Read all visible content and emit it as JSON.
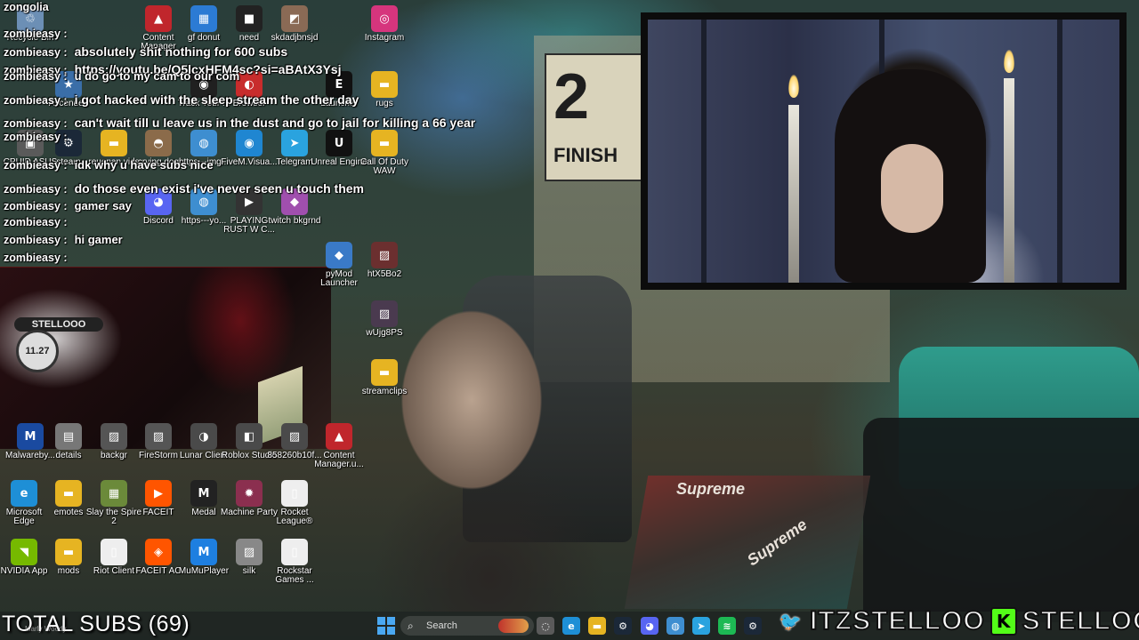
{
  "chat": {
    "lines": [
      {
        "user": "zongolia",
        "msg": ""
      },
      {
        "user": "zombieasy :",
        "msg": ""
      },
      {
        "user": "zombieasy :",
        "msg": "absolutely shit nothing for 600 subs"
      },
      {
        "user": "zombieasy :",
        "msg": "https://youtu.be/Q5lcxHFM4sc?si=aBAtX3Ysj"
      },
      {
        "user": "zombieasy :",
        "msg": "u do go to my cam to our com"
      },
      {
        "user": "zombieasy :",
        "msg": "i got hacked with the sleep stream the other day"
      },
      {
        "user": "zombieasy :",
        "msg": "can't wait till u leave us in the dust and go to jail for killing a 66 year"
      },
      {
        "user": "zombieasy :",
        "msg": ""
      },
      {
        "user": "zombieasy :",
        "msg": "idk why u have subs nice"
      },
      {
        "user": "zombieasy :",
        "msg": "do those even exist i've never seen u touch them"
      },
      {
        "user": "zombieasy :",
        "msg": "gamer say"
      },
      {
        "user": "zombieasy :",
        "msg": ""
      },
      {
        "user": "zombieasy :",
        "msg": "hi gamer"
      },
      {
        "user": "zombieasy :",
        "msg": ""
      }
    ]
  },
  "desktop_icons": [
    {
      "label": "Recycle Bin",
      "glyph": "♲",
      "color": "#6c8fb5"
    },
    {
      "label": "Content Manager",
      "glyph": "▲",
      "color": "#c0262c"
    },
    {
      "label": "gf donut",
      "glyph": "▦",
      "color": "#2c7bd4"
    },
    {
      "label": "need",
      "glyph": "■",
      "color": "#222222"
    },
    {
      "label": "skdadjbnsjd",
      "glyph": "◩",
      "color": "#8a6a55"
    },
    {
      "label": "Instagram",
      "glyph": "◎",
      "color": "#d6357d"
    },
    {
      "label": "Ascended",
      "glyph": "★",
      "color": "#3a6ea8"
    },
    {
      "label": "Track Your ...",
      "glyph": "◉",
      "color": "#202020"
    },
    {
      "label": "Browser",
      "glyph": "◐",
      "color": "#c82c2c"
    },
    {
      "label": "Launcher",
      "glyph": "E",
      "color": "#111111"
    },
    {
      "label": "rugs",
      "glyph": "▬",
      "color": "#e6b422"
    },
    {
      "label": "CPUID ASUS",
      "glyph": "▣",
      "color": "#5a5a5a"
    },
    {
      "label": "steam",
      "glyph": "⚙",
      "color": "#1b2838"
    },
    {
      "label": "reuenan vids",
      "glyph": "▬",
      "color": "#e6b422"
    },
    {
      "label": "crying dog",
      "glyph": "◓",
      "color": "#8b6b4a"
    },
    {
      "label": "https---img...",
      "glyph": "◍",
      "color": "#3e8ed0"
    },
    {
      "label": "FiveM.Visua...",
      "glyph": "◉",
      "color": "#1f86d1"
    },
    {
      "label": "Telegram",
      "glyph": "➤",
      "color": "#2aa3df"
    },
    {
      "label": "Unreal Engine",
      "glyph": "U",
      "color": "#111111"
    },
    {
      "label": "Call Of Duty WAW",
      "glyph": "▬",
      "color": "#e6b422"
    },
    {
      "label": "Discord",
      "glyph": "◕",
      "color": "#5865f2"
    },
    {
      "label": "https---yo...",
      "glyph": "◍",
      "color": "#3e8ed0"
    },
    {
      "label": "PLAYING RUST W C...",
      "glyph": "▶",
      "color": "#333333"
    },
    {
      "label": "twitch bkgrnd",
      "glyph": "◆",
      "color": "#a04fae"
    },
    {
      "label": "pyMod Launcher",
      "glyph": "◆",
      "color": "#3a7ac7"
    },
    {
      "label": "htX5Bo2",
      "glyph": "▨",
      "color": "#6b2f2f"
    },
    {
      "label": "wUjg8PS",
      "glyph": "▨",
      "color": "#4a3a4f"
    },
    {
      "label": "streamclips",
      "glyph": "▬",
      "color": "#e6b422"
    },
    {
      "label": "Malwareby...",
      "glyph": "M",
      "color": "#1a4aa0"
    },
    {
      "label": "details",
      "glyph": "▤",
      "color": "#777777"
    },
    {
      "label": "backgr",
      "glyph": "▨",
      "color": "#555555"
    },
    {
      "label": "FireStorm",
      "glyph": "▨",
      "color": "#555555"
    },
    {
      "label": "Lunar Client",
      "glyph": "◑",
      "color": "#4a4a4a"
    },
    {
      "label": "Roblox Studio",
      "glyph": "◧",
      "color": "#4a4a4a"
    },
    {
      "label": "858260b10f...",
      "glyph": "▨",
      "color": "#4a4a4a"
    },
    {
      "label": "Content Manager.u...",
      "glyph": "▲",
      "color": "#c0262c"
    },
    {
      "label": "Microsoft Edge",
      "glyph": "e",
      "color": "#1e8fd6"
    },
    {
      "label": "emotes",
      "glyph": "▬",
      "color": "#e6b422"
    },
    {
      "label": "Slay the Spire 2",
      "glyph": "▦",
      "color": "#6b8a3a"
    },
    {
      "label": "FACEIT",
      "glyph": "▶",
      "color": "#ff5500"
    },
    {
      "label": "Medal",
      "glyph": "M",
      "color": "#222222"
    },
    {
      "label": "Machine Party",
      "glyph": "✹",
      "color": "#8b2f4f"
    },
    {
      "label": "Rocket League®",
      "glyph": "▯",
      "color": "#eeeeee"
    },
    {
      "label": "NVIDIA App",
      "glyph": "◥",
      "color": "#76b900"
    },
    {
      "label": "mods",
      "glyph": "▬",
      "color": "#e6b422"
    },
    {
      "label": "Riot Client",
      "glyph": "▯",
      "color": "#eeeeee"
    },
    {
      "label": "FACEIT AC",
      "glyph": "◈",
      "color": "#ff5500"
    },
    {
      "label": "MuMuPlayer",
      "glyph": "M",
      "color": "#1e7fe0"
    },
    {
      "label": "silk",
      "glyph": "▨",
      "color": "#888888"
    },
    {
      "label": "Rockstar Games ...",
      "glyph": "▯",
      "color": "#eeeeee"
    }
  ],
  "webcam_inset": {
    "banner": "STELLOOO",
    "disc": "11.27"
  },
  "background_scene": {
    "sign_number": "2",
    "sign_word": "FINISH",
    "rug_text": "Supreme",
    "rug_text_2": "Supreme"
  },
  "taskbar": {
    "search_placeholder": "Search",
    "search_icon": "search-icon",
    "start_icon": "windows-start-icon",
    "apps": [
      {
        "name": "copilot-icon",
        "glyph": "◌",
        "color": "#5a5a5a"
      },
      {
        "name": "edge-icon",
        "glyph": "e",
        "color": "#1e8fd6"
      },
      {
        "name": "file-explorer-icon",
        "glyph": "▬",
        "color": "#e6b422"
      },
      {
        "name": "steam-icon",
        "glyph": "⚙",
        "color": "#1b2838"
      },
      {
        "name": "discord-icon",
        "glyph": "◕",
        "color": "#5865f2"
      },
      {
        "name": "chrome-icon",
        "glyph": "◍",
        "color": "#3e8ed0"
      },
      {
        "name": "telegram-icon",
        "glyph": "➤",
        "color": "#2aa3df"
      },
      {
        "name": "spotify-icon",
        "glyph": "≋",
        "color": "#1db954"
      },
      {
        "name": "steam-icon-2",
        "glyph": "⚙",
        "color": "#1b2838"
      }
    ]
  },
  "overlay": {
    "total_subs": "TOTAL SUBS (69)",
    "twitter_handle": "ITZSTELLOO",
    "kick_handle": "STELLOOO",
    "twitter_icon": "twitter-bird-icon",
    "kick_icon": "kick-k-icon",
    "kick_letter": "K",
    "twitter_glyph": "🐦",
    "mini_caption": "Marly Woody"
  },
  "colors": {
    "kick_green": "#53fc18",
    "twitter_blue": "#1da1f2"
  }
}
